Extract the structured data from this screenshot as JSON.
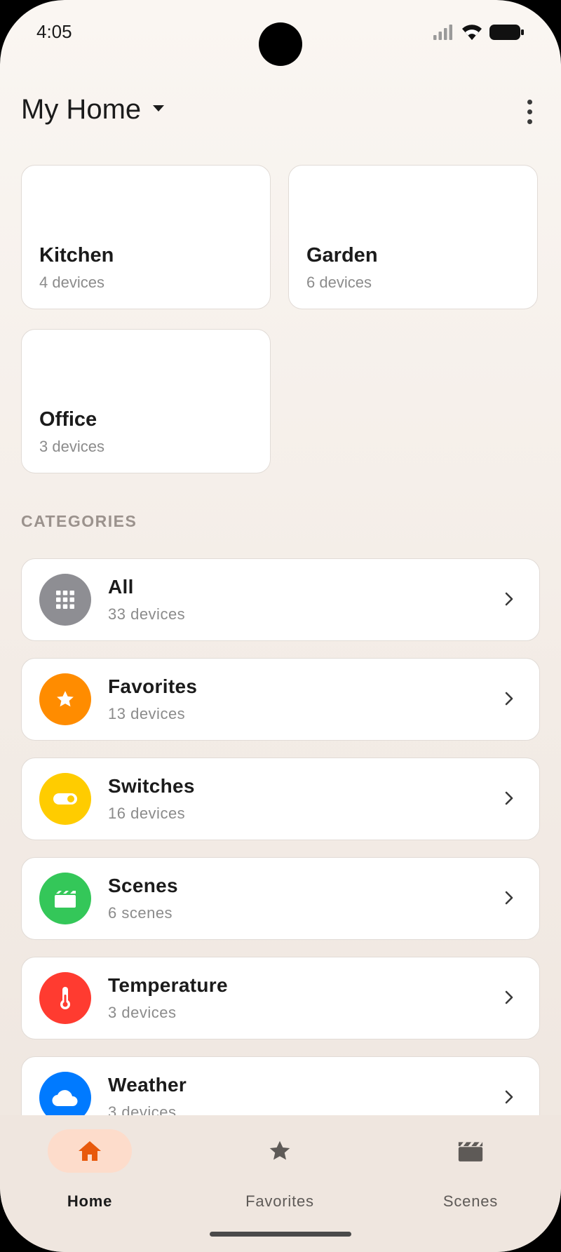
{
  "status_bar": {
    "time": "4:05",
    "icons": [
      "cellular-signal-icon",
      "wifi-icon",
      "battery-icon"
    ]
  },
  "header": {
    "title": "My Home",
    "dropdown_icon": "caret-down-icon",
    "menu_icon": "more-vert-icon"
  },
  "rooms": [
    {
      "name": "Kitchen",
      "count": "4 devices"
    },
    {
      "name": "Garden",
      "count": "6 devices"
    },
    {
      "name": "Office",
      "count": "3 devices"
    }
  ],
  "categories_label": "CATEGORIES",
  "categories": [
    {
      "name": "All",
      "count": "33 devices",
      "icon": "grid-icon",
      "color": "#8e8e93"
    },
    {
      "name": "Favorites",
      "count": "13 devices",
      "icon": "star-icon",
      "color": "#ff8c00"
    },
    {
      "name": "Switches",
      "count": "16 devices",
      "icon": "toggle-icon",
      "color": "#ffcc00"
    },
    {
      "name": "Scenes",
      "count": "6 scenes",
      "icon": "clapperboard-icon",
      "color": "#34c759"
    },
    {
      "name": "Temperature",
      "count": "3 devices",
      "icon": "thermometer-icon",
      "color": "#ff3b30"
    },
    {
      "name": "Weather",
      "count": "3 devices",
      "icon": "cloud-icon",
      "color": "#007aff"
    }
  ],
  "bottom_nav": {
    "items": [
      {
        "label": "Home",
        "icon": "home-icon",
        "active": true
      },
      {
        "label": "Favorites",
        "icon": "star-icon",
        "active": false
      },
      {
        "label": "Scenes",
        "icon": "clapperboard-icon",
        "active": false
      }
    ]
  },
  "colors": {
    "accent": "#e8590c",
    "active_pill": "#fddccb",
    "background": "#f6f0eb"
  }
}
